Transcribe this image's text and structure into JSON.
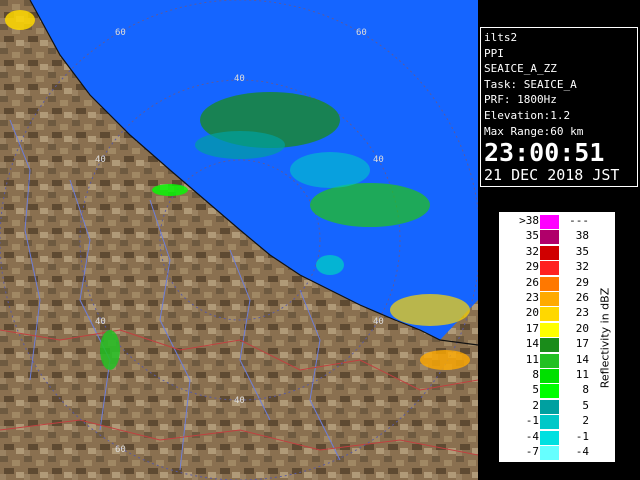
{
  "info": {
    "site": "ilts2",
    "mode": "PPI",
    "product": "SEAICE_A_ZZ",
    "task": "Task: SEAICE_A",
    "prf": "PRF: 1800Hz",
    "elevation": "Elevation:1.2",
    "max_range": "Max Range:60 km",
    "time": "23:00:51",
    "date": "21 DEC 2018 JST"
  },
  "map": {
    "range_labels": [
      "60",
      "40",
      "60",
      "40",
      "40",
      "40",
      "40",
      "40",
      "60"
    ],
    "sea_color": "#1565ff",
    "land_color": "#8a7050",
    "ring_color": "#5a5aa0"
  },
  "legend": {
    "title": "Reflectivity in dBZ",
    "rows": [
      {
        "lo": ">38",
        "hi": "---",
        "color": "#ff00ff"
      },
      {
        "lo": "35",
        "hi": "38",
        "color": "#b0006a"
      },
      {
        "lo": "32",
        "hi": "35",
        "color": "#d00000"
      },
      {
        "lo": "29",
        "hi": "32",
        "color": "#ff2020"
      },
      {
        "lo": "26",
        "hi": "29",
        "color": "#ff7800"
      },
      {
        "lo": "23",
        "hi": "26",
        "color": "#ffaa00"
      },
      {
        "lo": "20",
        "hi": "23",
        "color": "#ffd800"
      },
      {
        "lo": "17",
        "hi": "20",
        "color": "#ffff00"
      },
      {
        "lo": "14",
        "hi": "17",
        "color": "#1a8c1a"
      },
      {
        "lo": "11",
        "hi": "14",
        "color": "#22c022"
      },
      {
        "lo": "8",
        "hi": "11",
        "color": "#00e000"
      },
      {
        "lo": "5",
        "hi": "8",
        "color": "#00ff00"
      },
      {
        "lo": "2",
        "hi": "5",
        "color": "#00a0a0"
      },
      {
        "lo": "-1",
        "hi": "2",
        "color": "#00c8c8"
      },
      {
        "lo": "-4",
        "hi": "-1",
        "color": "#00e0e0"
      },
      {
        "lo": "-7",
        "hi": "-4",
        "color": "#66ffff"
      }
    ]
  }
}
